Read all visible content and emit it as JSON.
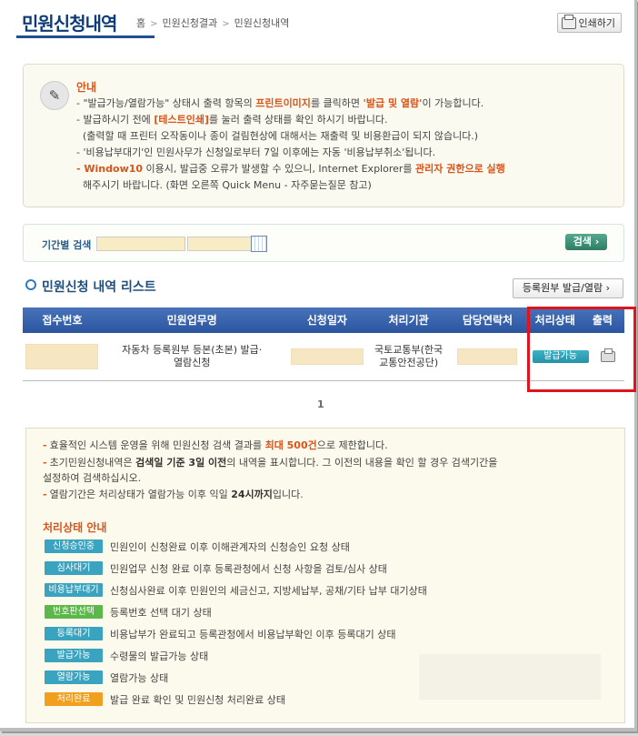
{
  "header": {
    "title": "민원신청내역",
    "breadcrumb": [
      "홈",
      "민원신청결과",
      "민원신청내역"
    ],
    "print_label": "인쇄하기"
  },
  "notice": {
    "title": "안내",
    "l1_a": "\"발급가능/열람가능\" 상태시 출력 항목의 ",
    "l1_b": "프린트이미지",
    "l1_c": "를 클릭하면 ",
    "l1_d": "'발급 및 열람'",
    "l1_e": "이 가능합니다.",
    "l2_a": "발급하시기 전에 ",
    "l2_b": "[테스트인쇄]",
    "l2_c": "를 눌러 출력 상태를 확인 하시기 바랍니다.",
    "l3": "(출력할 때 프린터 오작동이나 종이 걸림현상에 대해서는 재출력 및 비용환급이 되지 않습니다.)",
    "l4": "'비용납부대기'인 민원사무가 신청일로부터 7일 이후에는 자동 '비용납부취소'됩니다.",
    "l5_a": "Window10",
    "l5_b": " 이용시, 발급중 오류가 발생할 수 있으니, Internet Explorer를 ",
    "l5_c": "관리자 권한으로 실행",
    "l6": "해주시기 바랍니다. (화면 오른쪽 Quick Menu - 자주묻는질문 참고)"
  },
  "search": {
    "label": "기간별 검색",
    "button": "검색"
  },
  "list": {
    "title": "민원신청 내역 리스트",
    "reg_button": "등록원부 발급/열람"
  },
  "table": {
    "headers": [
      "접수번호",
      "민원업무명",
      "신청일자",
      "처리기관",
      "담당연락처",
      "처리상태",
      "출력"
    ],
    "row": {
      "task": "자동차 등록원부 등본(초본) 발급·열람신청",
      "agency": "국토교통부(한국교통안전공단)",
      "status": "발급가능"
    }
  },
  "pagination": {
    "current": "1"
  },
  "info": {
    "b1_a": "효율적인 시스템 운영을 위해 민원신청 검색 결과를 ",
    "b1_b": "최대 500건",
    "b1_c": "으로 제한합니다.",
    "b2_a": "초기민원신청내역은 ",
    "b2_b": "검색일 기준 3일 이전",
    "b2_c": "의 내역을 표시합니다. 그 이전의 내용을 확인 할 경우 검색기간을",
    "b2_d": "설정하여 검색하십시오.",
    "b3_a": "열람기간은 처리상태가 열람가능 이후 익일 ",
    "b3_b": "24시까지",
    "b3_c": "입니다.",
    "status_title": "처리상태 안내",
    "statuses": [
      {
        "badge": "신청승인중",
        "desc": "민원인이 신청완료 이후 이해관계자의 신청승인 요청 상태",
        "color": "#3aa4c0"
      },
      {
        "badge": "심사대기",
        "desc": "민원업무 신청 완료 이후 등록관청에서 신청 사항을 검토/심사 상태",
        "color": "#3aa4c0"
      },
      {
        "badge": "비용납부대기",
        "desc": "신청심사완료 이후 민원인의 세금신고, 지방세납부, 공채/기타 납부 대기상태",
        "color": "#3aa4c0"
      },
      {
        "badge": "번호판선택",
        "desc": "등록번호 선택 대기 상태",
        "color": "#5cb84a"
      },
      {
        "badge": "등록대기",
        "desc": "비용납부가 완료되고 등록관청에서 비용납부확인 이후 등록대기 상태",
        "color": "#3aa4c0"
      },
      {
        "badge": "발급가능",
        "desc": "수령물의 발급가능 상태",
        "color": "#3aa4c0"
      },
      {
        "badge": "열람가능",
        "desc": "열람가능 상태",
        "color": "#3aa4c0"
      },
      {
        "badge": "처리완료",
        "desc": "발급 완료 확인 및 민원신청 처리완료 상태",
        "color": "#f0a01e"
      }
    ]
  }
}
